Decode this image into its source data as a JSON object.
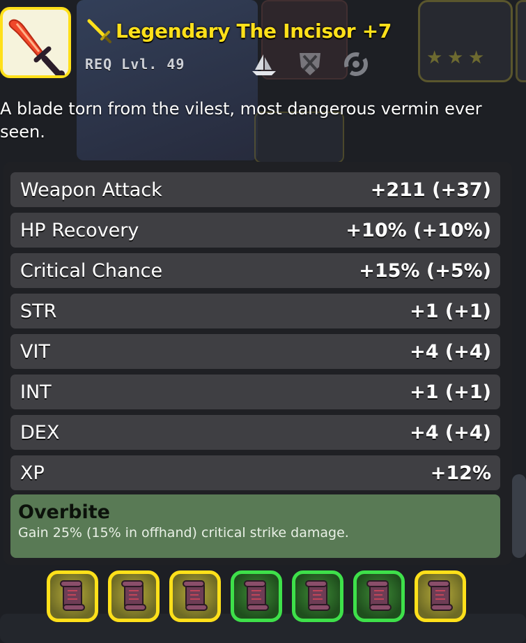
{
  "item": {
    "title": "Legendary The Incisor +7",
    "requirement": "REQ Lvl. 49",
    "description": "A blade torn from the vilest, most dangerous vermin ever seen.",
    "rarity_color": "#ffe01a",
    "icon": "sword-icon",
    "type_icons": [
      "ship-icon",
      "shield-icon",
      "swirl-icon"
    ]
  },
  "stats": [
    {
      "label": "Weapon Attack",
      "value": "+211 (+37)"
    },
    {
      "label": "HP Recovery",
      "value": "+10% (+10%)"
    },
    {
      "label": "Critical Chance",
      "value": "+15% (+5%)"
    },
    {
      "label": "STR",
      "value": "+1 (+1)"
    },
    {
      "label": "VIT",
      "value": "+4 (+4)"
    },
    {
      "label": "INT",
      "value": "+1 (+1)"
    },
    {
      "label": "DEX",
      "value": "+4 (+4)"
    },
    {
      "label": "XP",
      "value": "+12%"
    }
  ],
  "ability": {
    "name": "Overbite",
    "description": "Gain 25% (15% in offhand) critical strike damage."
  },
  "upgrade_slots": [
    {
      "icon": "scroll-icon",
      "color": "gold"
    },
    {
      "icon": "scroll-icon",
      "color": "gold"
    },
    {
      "icon": "scroll-icon",
      "color": "gold"
    },
    {
      "icon": "scroll-icon",
      "color": "green"
    },
    {
      "icon": "scroll-icon",
      "color": "green"
    },
    {
      "icon": "scroll-icon",
      "color": "green"
    },
    {
      "icon": "scroll-icon",
      "color": "gold"
    }
  ]
}
